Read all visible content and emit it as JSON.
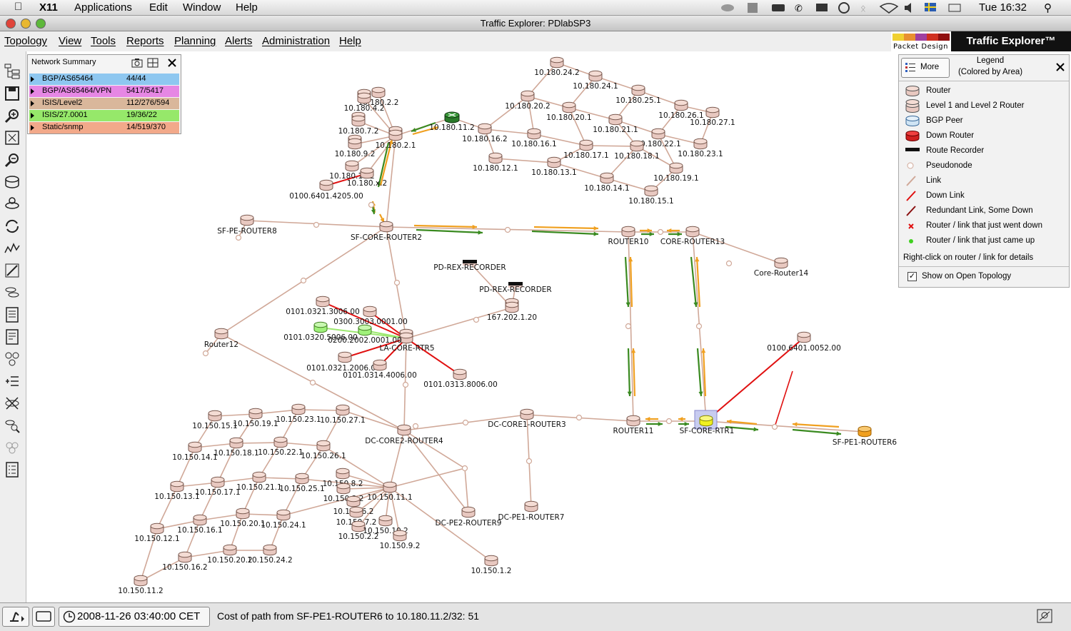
{
  "mac_menubar": {
    "app": "X11",
    "menus": [
      "Applications",
      "Edit",
      "Window",
      "Help"
    ],
    "clock": "Tue 16:32"
  },
  "window": {
    "title": "Traffic Explorer: PDlabSP3"
  },
  "app_menu": [
    "Topology",
    "View",
    "Tools",
    "Reports",
    "Planning",
    "Alerts",
    "Administration",
    "Help"
  ],
  "brand": {
    "vendor": "Packet Design",
    "product": "Traffic Explorer™"
  },
  "network_summary": {
    "title": "Network Summary",
    "rows": [
      {
        "name": "BGP/AS65464",
        "value": "44/44",
        "color": "#8ec7f0"
      },
      {
        "name": "BGP/AS65464/VPN",
        "value": "5417/5417",
        "color": "#e687e4"
      },
      {
        "name": "ISIS/Level2",
        "value": "112/276/594",
        "color": "#d9b79b"
      },
      {
        "name": "ISIS/27.0001",
        "value": "19/36/22",
        "color": "#96e86a"
      },
      {
        "name": "Static/snmp",
        "value": "14/519/370",
        "color": "#f2a98a"
      }
    ]
  },
  "legend": {
    "more_label": "More",
    "title": "Legend",
    "subtitle": "(Colored by Area)",
    "items": [
      {
        "label": "Router",
        "icon": "router-icon"
      },
      {
        "label": "Level 1 and Level 2 Router",
        "icon": "l1l2-router-icon"
      },
      {
        "label": "BGP Peer",
        "icon": "bgp-peer-icon"
      },
      {
        "label": "Down Router",
        "icon": "down-router-icon"
      },
      {
        "label": "Route Recorder",
        "icon": "route-recorder-icon"
      },
      {
        "label": "Pseudonode",
        "icon": "pseudonode-icon"
      },
      {
        "label": "Link",
        "icon": "link-icon"
      },
      {
        "label": "Down Link",
        "icon": "down-link-icon"
      },
      {
        "label": "Redundant Link, Some Down",
        "icon": "redundant-link-icon"
      },
      {
        "label": "Router / link that just went down",
        "icon": "went-down-icon"
      },
      {
        "label": "Router / link that just came up",
        "icon": "came-up-icon"
      }
    ],
    "hint": "Right-click on router / link for details",
    "show_on_open_label": "Show on Open Topology",
    "show_on_open_checked": true
  },
  "status": {
    "datetime": "2008-11-26 03:40:00 CET",
    "message": "Cost of path from SF-PE1-ROUTER6 to 10.180.11.2/32: 51"
  },
  "colors": {
    "link": "#d0a898",
    "down_link": "#e01010",
    "redundant_link": "#8a1010",
    "path_green": "#3a8a20",
    "path_orange": "#f0a020",
    "router": "#e8c8c0",
    "router_up": "#9ff07a",
    "highlight_router": "#f0f020",
    "pe6_router": "#f0a020"
  },
  "topology": {
    "routers": [
      {
        "id": "sf-core-router2",
        "label": "SF-CORE-ROUTER2"
      },
      {
        "id": "sf-pe-router8",
        "label": "SF-PE-ROUTER8"
      },
      {
        "id": "router10",
        "label": "ROUTER10"
      },
      {
        "id": "core-router13",
        "label": "CORE-ROUTER13"
      },
      {
        "id": "core-router14",
        "label": "Core-Router14"
      },
      {
        "id": "router12",
        "label": "Router12"
      },
      {
        "id": "la-core-rtr5",
        "label": "LA-CORE-RTR5"
      },
      {
        "id": "pd-rex-recorder-1",
        "label": "PD-REX-RECORDER"
      },
      {
        "id": "pd-rex-recorder-2",
        "label": "PD-REX-RECORDER"
      },
      {
        "id": "n167",
        "label": "167.202.1.20"
      },
      {
        "id": "dc-core2-router4",
        "label": "DC-CORE2-ROUTER4"
      },
      {
        "id": "dc-core1-router3",
        "label": "DC-CORE1-ROUTER3"
      },
      {
        "id": "router11",
        "label": "ROUTER11"
      },
      {
        "id": "sf-core-rtr1",
        "label": "SF-CORE-RTR1"
      },
      {
        "id": "sf-pe1-router6",
        "label": "SF-PE1-ROUTER6"
      },
      {
        "id": "dc-pe2-router9",
        "label": "DC-PE2-ROUTER9"
      },
      {
        "id": "dc-pe1-router7",
        "label": "DC-PE1-ROUTER7"
      },
      {
        "id": "n0100-0052",
        "label": "0100.6401.0052.00"
      },
      {
        "id": "n0100-4205",
        "label": "0100.6401.4205.00"
      },
      {
        "id": "n0101-3006",
        "label": "0101.0321.3006.00"
      },
      {
        "id": "n0300-3003",
        "label": "0300.3003.0001.00"
      },
      {
        "id": "n0101-5006",
        "label": "0101.0320.5006.00"
      },
      {
        "id": "n0200-2002",
        "label": "0200.2002.0001.00"
      },
      {
        "id": "n0101-2006",
        "label": "0101.0321.2006.00"
      },
      {
        "id": "n0101-4006",
        "label": "0101.0314.4006.00"
      },
      {
        "id": "n0101-8006",
        "label": "0101.0313.8006.00"
      },
      {
        "id": "r180-11-2",
        "label": "10.180.11.2"
      },
      {
        "id": "r180-2-1",
        "label": "10.180.2.1"
      },
      {
        "id": "r180-2-2",
        "label": "10.180.2.2"
      },
      {
        "id": "r180-4-2",
        "label": "10.180.4.2"
      },
      {
        "id": "r180-7-2",
        "label": "10.180.7.2"
      },
      {
        "id": "r180-9-2",
        "label": "10.180.9.2"
      },
      {
        "id": "r180-10-2",
        "label": "10.180.10.2"
      },
      {
        "id": "r180-x-2",
        "label": "10.180.x.2"
      },
      {
        "id": "r180-24-2",
        "label": "10.180.24.2"
      },
      {
        "id": "r180-24-1",
        "label": "10.180.24.1"
      },
      {
        "id": "r180-25-1",
        "label": "10.180.25.1"
      },
      {
        "id": "r180-26-1",
        "label": "10.180.26.1"
      },
      {
        "id": "r180-27-1",
        "label": "10.180.27.1"
      },
      {
        "id": "r180-20-2",
        "label": "10.180.20.2"
      },
      {
        "id": "r180-20-1",
        "label": "10.180.20.1"
      },
      {
        "id": "r180-21-1",
        "label": "10.180.21.1"
      },
      {
        "id": "r180-22-1",
        "label": "10.180.22.1"
      },
      {
        "id": "r180-23-1",
        "label": "10.180.23.1"
      },
      {
        "id": "r180-16-2",
        "label": "10.180.16.2"
      },
      {
        "id": "r180-16-1",
        "label": "10.180.16.1"
      },
      {
        "id": "r180-17-1",
        "label": "10.180.17.1"
      },
      {
        "id": "r180-18-1",
        "label": "10.180.18.1"
      },
      {
        "id": "r180-19-1",
        "label": "10.180.19.1"
      },
      {
        "id": "r180-12-1",
        "label": "10.180.12.1"
      },
      {
        "id": "r180-13-1",
        "label": "10.180.13.1"
      },
      {
        "id": "r180-14-1",
        "label": "10.180.14.1"
      },
      {
        "id": "r180-15-1",
        "label": "10.180.15.1"
      },
      {
        "id": "r150-15-1",
        "label": "10.150.15.1"
      },
      {
        "id": "r150-19-1",
        "label": "10.150.19.1"
      },
      {
        "id": "r150-23-1",
        "label": "10.150.23.1"
      },
      {
        "id": "r150-27-1",
        "label": "10.150.27.1"
      },
      {
        "id": "r150-14-1",
        "label": "10.150.14.1"
      },
      {
        "id": "r150-18-1",
        "label": "10.150.18.1"
      },
      {
        "id": "r150-22-1",
        "label": "10.150.22.1"
      },
      {
        "id": "r150-26-1",
        "label": "10.150.26.1"
      },
      {
        "id": "r150-13-1",
        "label": "10.150.13.1"
      },
      {
        "id": "r150-17-1",
        "label": "10.150.17.1"
      },
      {
        "id": "r150-21-1",
        "label": "10.150.21.1"
      },
      {
        "id": "r150-25-1",
        "label": "10.150.25.1"
      },
      {
        "id": "r150-12-1",
        "label": "10.150.12.1"
      },
      {
        "id": "r150-16-1",
        "label": "10.150.16.1"
      },
      {
        "id": "r150-20-1",
        "label": "10.150.20.1"
      },
      {
        "id": "r150-24-1",
        "label": "10.150.24.1"
      },
      {
        "id": "r150-11-2",
        "label": "10.150.11.2"
      },
      {
        "id": "r150-16-2",
        "label": "10.150.16.2"
      },
      {
        "id": "r150-20-2",
        "label": "10.150.20.2"
      },
      {
        "id": "r150-24-2",
        "label": "10.150.24.2"
      },
      {
        "id": "r150-11-1",
        "label": "10.150.11.1"
      },
      {
        "id": "r150-8-2",
        "label": "10.150.8.2"
      },
      {
        "id": "r150-3-2",
        "label": "10.150.3.2"
      },
      {
        "id": "r150-6-2",
        "label": "10.150.6.2"
      },
      {
        "id": "r150-7-2",
        "label": "10.150.7.2"
      },
      {
        "id": "r150-2-2",
        "label": "10.150.2.2"
      },
      {
        "id": "r150-10-2",
        "label": "10.150.10.2"
      },
      {
        "id": "r150-9-2",
        "label": "10.150.9.2"
      },
      {
        "id": "r150-1-2",
        "label": "10.150.1.2"
      }
    ]
  }
}
